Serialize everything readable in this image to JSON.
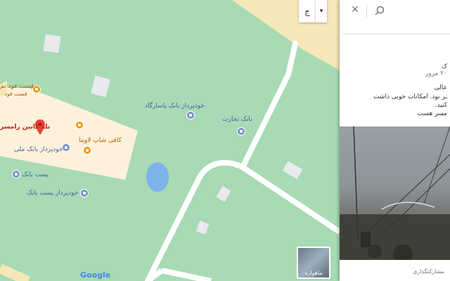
{
  "map": {
    "place_labels": [
      {
        "id": "bus-terminal",
        "text": "تله کابین رامسر"
      },
      {
        "id": "fastfood",
        "text": "فست فود نم"
      },
      {
        "id": "fastfood-sub",
        "text": "فست فود"
      },
      {
        "id": "cafe",
        "text": "کافی شاپ لاوینا"
      },
      {
        "id": "atm-melli",
        "text": "خودپرداز بانک ملی"
      },
      {
        "id": "bank-post",
        "text": "پست بانک"
      },
      {
        "id": "atm-post",
        "text": "خودپرداز پست بانک"
      },
      {
        "id": "atm-pasargad",
        "text": "خودپرداز بانک پاسارگاد"
      },
      {
        "id": "bank-tejarat",
        "text": "بانک تجارت"
      }
    ],
    "google_logo": "Google",
    "satellite_label": "ماهواره"
  },
  "topbar": {
    "layer_button_glyph": "ج",
    "dropdown_glyph": "▾"
  },
  "panel": {
    "search_placeholder": "",
    "review_lines": [
      "ک",
      "۲۰ مرور",
      "عالی",
      "ـر بود. امکانات خوبی داشت",
      "کنید.",
      "مسر هست"
    ],
    "contribute_label": "مشارکتگذاری"
  },
  "colors": {
    "park": "#a8dab5",
    "commercial": "#fdf1dc",
    "road": "#ffffff",
    "water": "#7eb3ea",
    "building": "#e8eaed"
  }
}
